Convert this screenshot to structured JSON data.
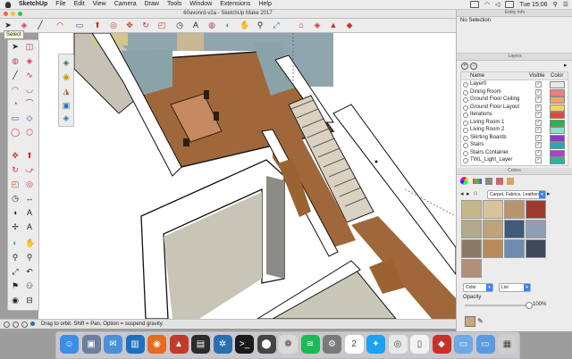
{
  "menubar": {
    "app": "SketchUp",
    "items": [
      "File",
      "Edit",
      "View",
      "Camera",
      "Draw",
      "Tools",
      "Window",
      "Extensions",
      "Help"
    ],
    "clock": "Tue 15:06"
  },
  "window": {
    "title": "60avonrd-v2a - SketchUp Make 2017"
  },
  "toolbar": {
    "tooltip": "Select"
  },
  "status": {
    "text": "Drag to orbit. Shift = Pan, Option = suspend gravity."
  },
  "entity_info": {
    "title": "Entity Info",
    "selection": "No Selection"
  },
  "layers": {
    "title": "Layers",
    "col_name": "Name",
    "col_visible": "Visible",
    "col_color": "Color",
    "rows": [
      {
        "name": "Layer0",
        "color": "#e8e8e8"
      },
      {
        "name": "Dining Room",
        "color": "#f47c7c"
      },
      {
        "name": "Ground Floor Ceiling",
        "color": "#f0a46a"
      },
      {
        "name": "Ground Floor Layout",
        "color": "#f2d266"
      },
      {
        "name": "Iterations",
        "color": "#e3473c"
      },
      {
        "name": "Living Room 1",
        "color": "#2bb24a"
      },
      {
        "name": "Living Room 2",
        "color": "#8be0d0"
      },
      {
        "name": "Skirting Boards",
        "color": "#8a3cc4"
      },
      {
        "name": "Stairs",
        "color": "#2aa6b8"
      },
      {
        "name": "Stairs Container",
        "color": "#b43dc8"
      },
      {
        "name": "TWL_Light_Layer",
        "color": "#25b59a"
      }
    ]
  },
  "colors": {
    "title": "Colors",
    "material_set": "Carpet, Fabrics, Leathers",
    "mode": "Color",
    "list_mode": "List",
    "opacity_label": "Opacity",
    "opacity_value": "100%",
    "swatches": [
      "#c4b78a",
      "#d9c39b",
      "#b8956d",
      "#9e3a2c",
      "#b2aa8c",
      "#c2a27a",
      "#3f5a7a",
      "#8fa0b3",
      "#8c7a66",
      "#b88a5a",
      "#6f8cb0",
      "#3c4a5c",
      "#b48e78"
    ]
  },
  "dock": {
    "apps": [
      {
        "name": "finder-icon",
        "color": "#3a8ee6",
        "glyph": "☺"
      },
      {
        "name": "preview-icon",
        "color": "#6c7fa0",
        "glyph": "▣"
      },
      {
        "name": "mail-icon",
        "color": "#4a90d9",
        "glyph": "✉"
      },
      {
        "name": "trello-icon",
        "color": "#1f6fc0",
        "glyph": "▥"
      },
      {
        "name": "firefox-icon",
        "color": "#e66a1f",
        "glyph": "◉"
      },
      {
        "name": "photos-icon",
        "color": "#c23b2a",
        "glyph": "▲"
      },
      {
        "name": "photobooth-icon",
        "color": "#2c2c2c",
        "glyph": "▤"
      },
      {
        "name": "network-icon",
        "color": "#2a6fb0",
        "glyph": "✲"
      },
      {
        "name": "terminal-icon",
        "color": "#1a1a1a",
        "glyph": ">_"
      },
      {
        "name": "steam-icon",
        "color": "#444",
        "glyph": "⬤"
      },
      {
        "name": "itunes-icon",
        "color": "#d9d9d9",
        "glyph": "❁"
      },
      {
        "name": "spotify-icon",
        "color": "#1db954",
        "glyph": "≋"
      },
      {
        "name": "system-prefs-icon",
        "color": "#7a7a7a",
        "glyph": "⚙"
      },
      {
        "name": "calendar-icon",
        "color": "#ffffff",
        "glyph": "2"
      },
      {
        "name": "twitter-icon",
        "color": "#1da1f2",
        "glyph": "✦"
      },
      {
        "name": "chrome-icon",
        "color": "#e8e8e8",
        "glyph": "◎"
      },
      {
        "name": "document-icon",
        "color": "#f2f2f2",
        "glyph": "▯"
      },
      {
        "name": "sketchup-icon",
        "color": "#c8312a",
        "glyph": "◆"
      },
      {
        "name": "folder-icon",
        "color": "#6fa8e6",
        "glyph": "▭"
      },
      {
        "name": "downloads-icon",
        "color": "#5a9ae0",
        "glyph": "▭"
      },
      {
        "name": "trash-icon",
        "color": "#cfcfcf",
        "glyph": "▦"
      }
    ]
  }
}
